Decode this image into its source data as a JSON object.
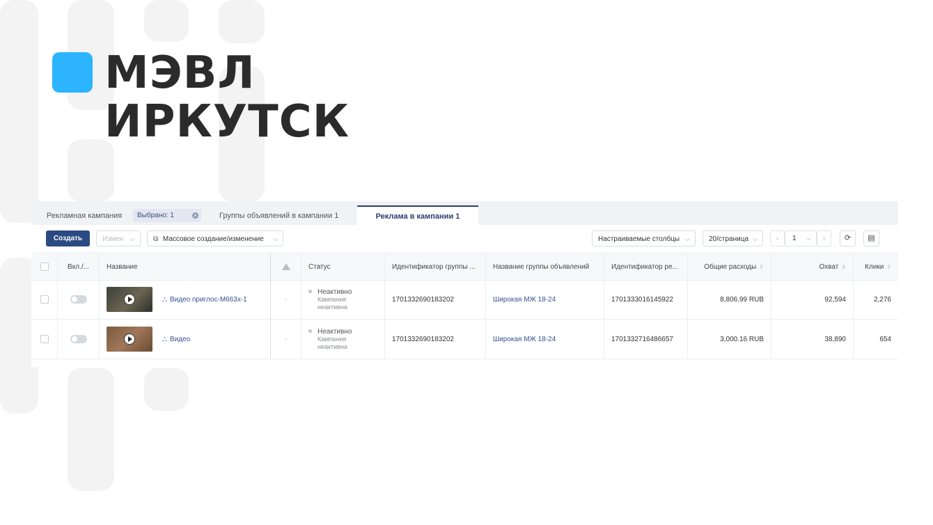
{
  "brand": {
    "line1": "МЭВЛ",
    "line2": "ИРКУТСК",
    "accent": "#2cb4ff"
  },
  "tabs": {
    "campaign_label": "Рекламная кампания",
    "selected_chip": "Выбрано: 1",
    "groups_tab": "Группы объявлений в кампании 1",
    "ads_tab": "Реклама в кампании 1"
  },
  "toolbar": {
    "create": "Создать",
    "edit": "Измен",
    "mass": "Массовое создание/изменение",
    "columns": "Настраиваемые столбцы",
    "page_size": "20/страница",
    "page": "1"
  },
  "table": {
    "headers": {
      "toggle": "Вкл./...",
      "name": "Название",
      "status": "Статус",
      "group_id": "Идентификатор группы ...",
      "group_name": "Название группы объявлений",
      "ad_id": "Идентификатор ре...",
      "spend": "Общие расходы",
      "reach": "Охват",
      "clicks": "Клики"
    },
    "rows": [
      {
        "name": "Видео приглос-М663х-1",
        "dash": "-",
        "status": "Неактивно",
        "status_sub1": "Кампания",
        "status_sub2": "неактивна",
        "group_id": "1701332690183202",
        "group_name": "Широкая МЖ 18-24",
        "ad_id": "1701333016145922",
        "spend": "8,806.99 RUB",
        "reach": "92,594",
        "clicks": "2,276"
      },
      {
        "name": "Видео",
        "dash": "-",
        "status": "Неактивно",
        "status_sub1": "Кампания",
        "status_sub2": "неактивна",
        "group_id": "1701332690183202",
        "group_name": "Широкая МЖ 18-24",
        "ad_id": "1701332716486657",
        "spend": "3,000.16 RUB",
        "reach": "38,890",
        "clicks": "654"
      }
    ]
  }
}
